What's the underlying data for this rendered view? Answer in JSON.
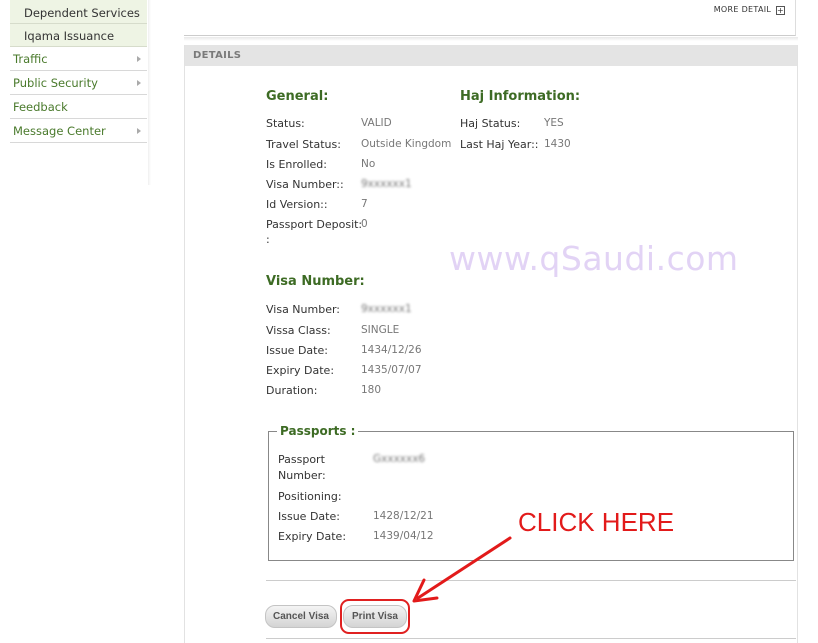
{
  "sidebar": {
    "subitems": [
      "Dependent Services",
      "Iqama Issuance"
    ],
    "items": [
      {
        "label": "Traffic",
        "has_arrow": true
      },
      {
        "label": "Public Security",
        "has_arrow": true
      },
      {
        "label": "Feedback",
        "has_arrow": false
      },
      {
        "label": "Message Center",
        "has_arrow": true
      }
    ]
  },
  "top_panel": {
    "more_detail": "MORE DETAIL",
    "more_detail_icon": "plus-box-icon"
  },
  "details": {
    "header": "DETAILS",
    "general": {
      "title": "General:",
      "fields": [
        {
          "label": "Status:",
          "value": "VALID"
        },
        {
          "label": "Travel Status:",
          "value": "Outside Kingdom"
        },
        {
          "label": "Is Enrolled:",
          "value": "No"
        },
        {
          "label": "Visa Number::",
          "value": "9xxxxxx1"
        },
        {
          "label": "Id Version::",
          "value": "7"
        },
        {
          "label": "Passport Deposit:",
          "label2": ":",
          "value": "0"
        }
      ]
    },
    "haj": {
      "title": "Haj Information:",
      "fields": [
        {
          "label": "Haj Status:",
          "value": "YES"
        },
        {
          "label": "Last Haj Year::",
          "value": "1430"
        }
      ]
    },
    "visa": {
      "title": "Visa Number:",
      "fields": [
        {
          "label": "Visa Number:",
          "value": "9xxxxxx1"
        },
        {
          "label": "Vissa Class:",
          "value": "SINGLE"
        },
        {
          "label": "Issue Date:",
          "value": "1434/12/26"
        },
        {
          "label": "Expiry Date:",
          "value": "1435/07/07"
        },
        {
          "label": "Duration:",
          "value": "180"
        }
      ]
    },
    "passports": {
      "legend": "Passports :",
      "fields": [
        {
          "label": "Passport",
          "label2": "Number:",
          "value": "Gxxxxxx6"
        },
        {
          "label": "Positioning:",
          "value": ""
        },
        {
          "label": "Issue Date:",
          "value": "1428/12/21"
        },
        {
          "label": "Expiry Date:",
          "value": "1439/04/12"
        }
      ]
    },
    "buttons": {
      "cancel": "Cancel Visa",
      "print": "Print Visa"
    }
  },
  "watermark": "www.qSaudi.com",
  "annotation": {
    "text": "CLICK HERE",
    "color": "#e21a1a"
  }
}
